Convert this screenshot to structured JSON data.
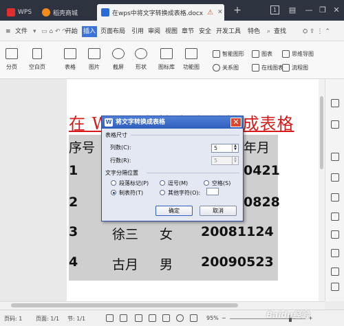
{
  "colors": {
    "title_red": "#d61a1a",
    "accent_blue": "#3b73d9",
    "table_gray": "#cfcfcf"
  },
  "tabs": [
    {
      "label": "WPS",
      "icon": "wps-logo-icon"
    },
    {
      "label": "稻壳商城",
      "icon": "daoke-icon"
    },
    {
      "label": "在wps中将文字转换成表格.docx",
      "icon": "doc-icon"
    }
  ],
  "titlebar": {
    "new_tab": "+",
    "page_num": "1"
  },
  "menu": {
    "file": "文件",
    "items": [
      "开始",
      "插入",
      "页面布局",
      "引用",
      "审阅",
      "视图",
      "章节",
      "安全",
      "开发工具",
      "特色"
    ],
    "active": "插入",
    "search": "查找"
  },
  "ribbon": {
    "large": [
      "分页",
      "空白页",
      "表格",
      "图片",
      "截屏",
      "形状",
      "图标库",
      "功能图"
    ],
    "small": [
      "智能图形",
      "图表",
      "思维导图",
      "关系图",
      "在线图表",
      "流程图"
    ]
  },
  "document": {
    "title": "在 WPS 中将文字转换成表格",
    "rows": [
      [
        "序号",
        "",
        "",
        "年月"
      ],
      [
        "1",
        "",
        "",
        "0421"
      ],
      [
        "2",
        "",
        "",
        "0828"
      ],
      [
        "3",
        "徐三",
        "女",
        "20081124"
      ],
      [
        "4",
        "古月",
        "男",
        "20090523"
      ]
    ]
  },
  "dialog": {
    "title": "将文字转换成表格",
    "size_group": "表格尺寸",
    "cols_label": "列数(C):",
    "cols_value": "5",
    "rows_label": "行数(R):",
    "rows_value": "5",
    "sep_group": "文字分隔位置",
    "options": [
      "段落标记(P)",
      "逗号(M)",
      "空格(S)",
      "制表符(T)",
      "其他字符(O):"
    ],
    "selected": "制表符(T)",
    "ok": "确定",
    "cancel": "取消"
  },
  "status": {
    "page": "页码: 1",
    "pages": "页面: 1/1",
    "section": "节: 1/1",
    "zoom": "95%"
  },
  "watermark": "Baidu经验"
}
